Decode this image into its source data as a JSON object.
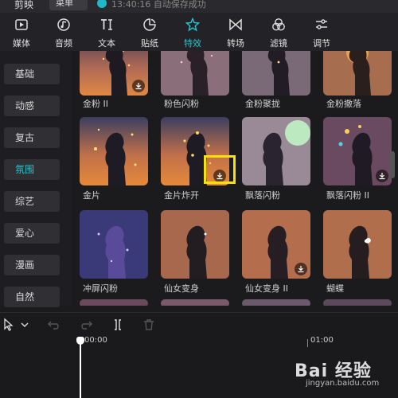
{
  "topbar": {
    "app_name": "剪映",
    "menu_label": "菜单",
    "status": "13:40:16 自动保存成功"
  },
  "toolbar": {
    "tabs": [
      {
        "label": "媒体",
        "icon": "media-icon"
      },
      {
        "label": "音频",
        "icon": "audio-icon"
      },
      {
        "label": "文本",
        "icon": "text-icon"
      },
      {
        "label": "贴纸",
        "icon": "sticker-icon"
      },
      {
        "label": "特效",
        "icon": "effects-icon",
        "active": true
      },
      {
        "label": "转场",
        "icon": "transition-icon"
      },
      {
        "label": "滤镜",
        "icon": "filter-icon"
      },
      {
        "label": "调节",
        "icon": "adjust-icon"
      }
    ],
    "active_color": "#25c6d0"
  },
  "categories": {
    "items": [
      "基础",
      "动感",
      "复古",
      "氛围",
      "综艺",
      "爱心",
      "漫画",
      "自然"
    ],
    "active": "氛围"
  },
  "effects": {
    "rows": [
      [
        "金粉 II",
        "粉色闪粉",
        "金粉聚拢",
        "金粉撒落"
      ],
      [
        "金片",
        "金片炸开",
        "飘落闪粉",
        "飘落闪粉 II"
      ],
      [
        "冲屏闪粉",
        "仙女变身",
        "仙女变身 II",
        "蝴蝶"
      ]
    ],
    "highlighted_download": "金片炸开"
  },
  "timeline": {
    "time_start": "00:00",
    "time_mark": "01:00"
  },
  "watermark": {
    "brand": "Bai 经验",
    "url": "jingyan.baidu.com"
  }
}
